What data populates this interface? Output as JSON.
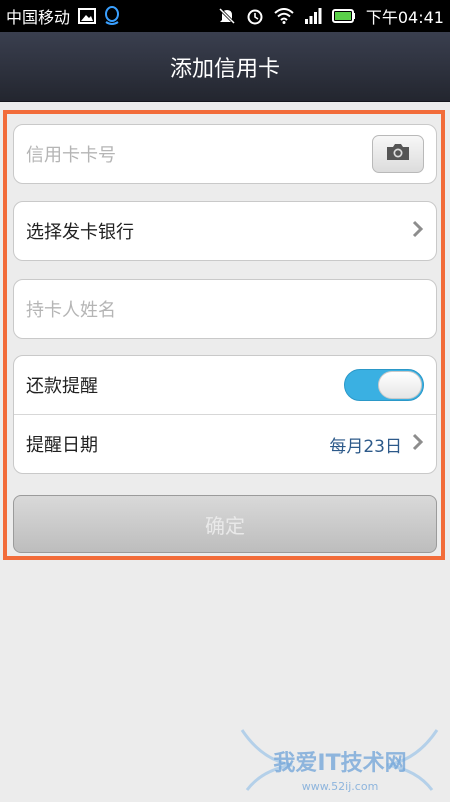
{
  "statusbar": {
    "carrier": "中国移动",
    "time": "下午04:41"
  },
  "header": {
    "title": "添加信用卡"
  },
  "form": {
    "card_number_placeholder": "信用卡卡号",
    "bank_label": "选择发卡银行",
    "holder_name_placeholder": "持卡人姓名",
    "reminder_label": "还款提醒",
    "reminder_on": true,
    "reminder_date_label": "提醒日期",
    "reminder_date_value": "每月23日",
    "confirm_label": "确定"
  },
  "watermark": {
    "text": "我爱IT技术网",
    "url": "www.52ij.com"
  },
  "colors": {
    "accent": "#3ab0e2",
    "highlight_border": "#f26c3a",
    "header_bg": "#2a2e39"
  }
}
